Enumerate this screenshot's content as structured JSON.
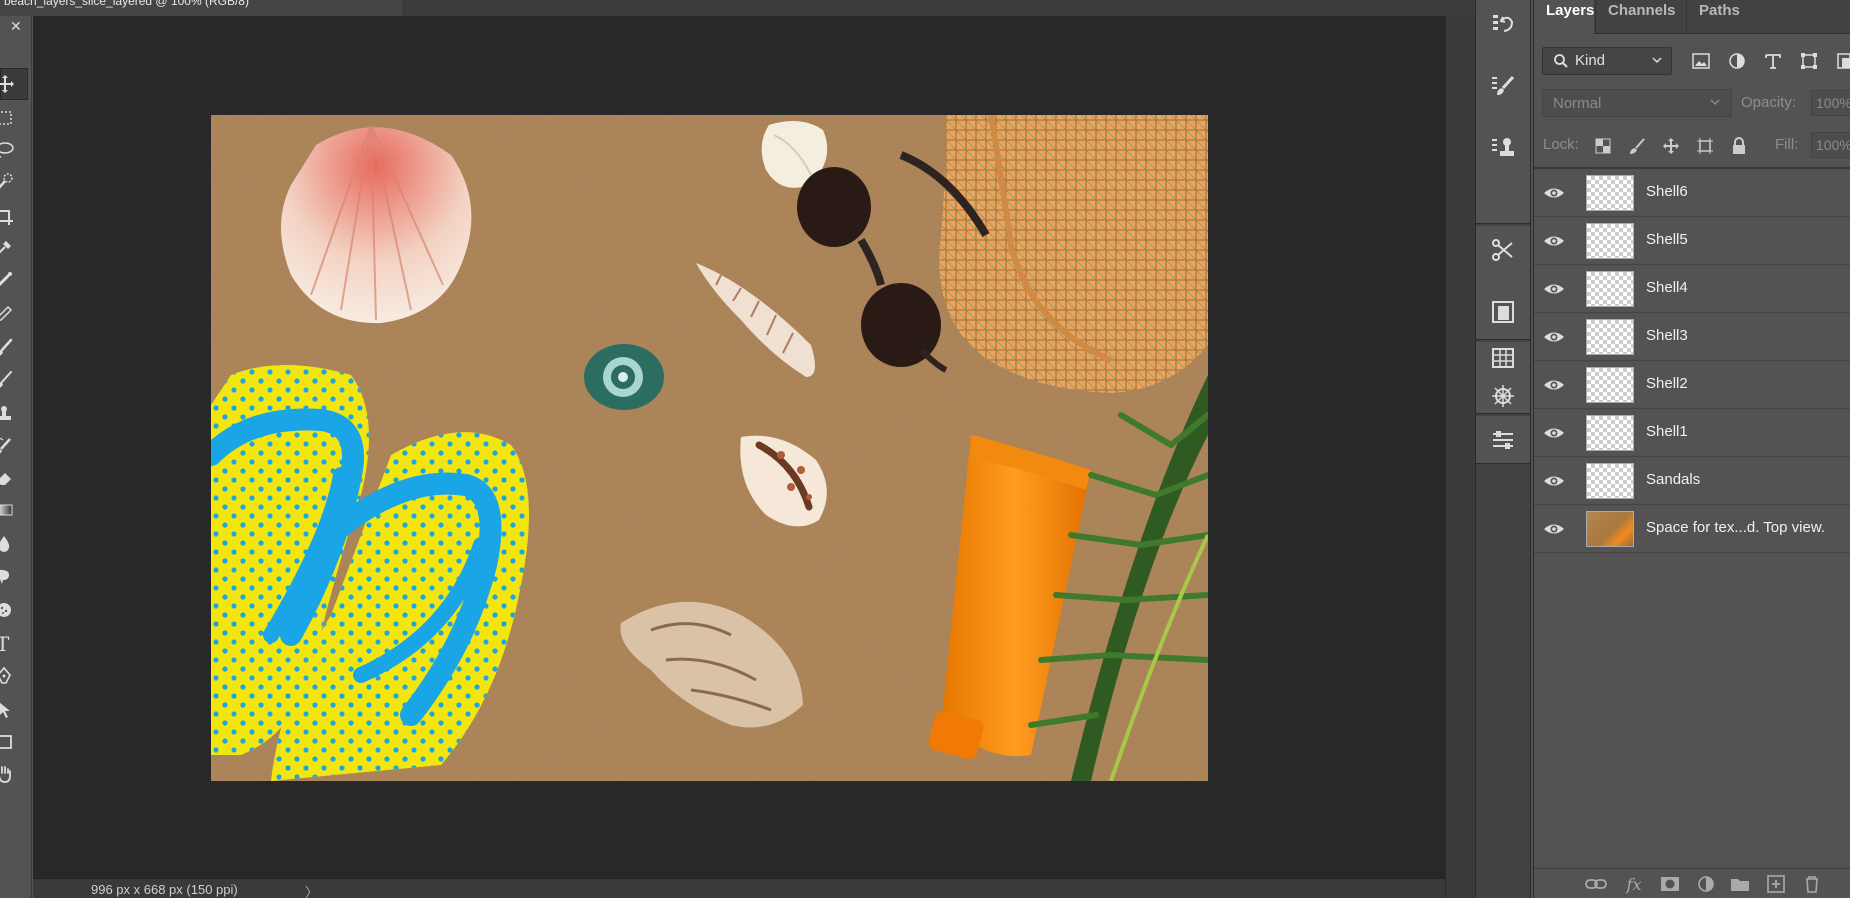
{
  "window": {
    "doc_tab_title": "beach_layers_slice_layered @ 100% (RGB/8)",
    "close_symbol": "×"
  },
  "toolbar": {
    "close_symbol": "✕",
    "tools": [
      {
        "name": "move-tool-icon",
        "active": true
      },
      {
        "name": "rectangular-marquee-icon"
      },
      {
        "name": "lasso-icon"
      },
      {
        "name": "quick-selection-icon"
      },
      {
        "name": "crop-icon"
      },
      {
        "name": "eyedropper-icon"
      },
      {
        "name": "spot-healing-brush-icon"
      },
      {
        "name": "pencil-icon"
      },
      {
        "name": "brush-icon"
      },
      {
        "name": "mixer-brush-icon"
      },
      {
        "name": "clone-stamp-icon"
      },
      {
        "name": "history-brush-icon"
      },
      {
        "name": "eraser-icon"
      },
      {
        "name": "gradient-icon"
      },
      {
        "name": "blur-icon"
      },
      {
        "name": "smudge-icon"
      },
      {
        "name": "sponge-icon"
      },
      {
        "name": "type-tool-icon",
        "glyph": "T"
      },
      {
        "name": "pen-icon"
      },
      {
        "name": "path-selection-icon"
      },
      {
        "name": "rectangle-shape-icon"
      },
      {
        "name": "hand-icon"
      }
    ]
  },
  "status_bar": {
    "doc_info": "996 px x 668 px (150 ppi)",
    "arrow": "〉"
  },
  "dock": {
    "icons": [
      "history-icon",
      "brush-settings-icon",
      "clone-source-icon",
      "tools-presets-icon",
      "libraries-icon",
      "grid-icon",
      "compass-icon",
      "adjustments-icon"
    ]
  },
  "layers_panel": {
    "tabs": [
      {
        "label": "Layers",
        "active": true
      },
      {
        "label": "Channels",
        "active": false
      },
      {
        "label": "Paths",
        "active": false
      }
    ],
    "filter_kind": "Kind",
    "filter_icons": [
      "image-filter-icon",
      "adjustment-filter-icon",
      "type-filter-icon",
      "shape-filter-icon",
      "smart-object-filter-icon"
    ],
    "blend_mode": "Normal",
    "opacity_label": "Opacity:",
    "opacity_value": "100%",
    "lock_label": "Lock:",
    "lock_icons": [
      "lock-transparent-icon",
      "lock-image-icon",
      "lock-position-icon",
      "lock-artboard-icon",
      "lock-all-icon"
    ],
    "fill_label": "Fill:",
    "fill_value": "100%",
    "layers": [
      {
        "name": "Shell6",
        "visible": true,
        "thumb": "transparent"
      },
      {
        "name": "Shell5",
        "visible": true,
        "thumb": "transparent"
      },
      {
        "name": "Shell4",
        "visible": true,
        "thumb": "transparent"
      },
      {
        "name": "Shell3",
        "visible": true,
        "thumb": "transparent"
      },
      {
        "name": "Shell2",
        "visible": true,
        "thumb": "transparent"
      },
      {
        "name": "Shell1",
        "visible": true,
        "thumb": "transparent"
      },
      {
        "name": "Sandals",
        "visible": true,
        "thumb": "transparent"
      },
      {
        "name": "Space for tex...d. Top view.",
        "visible": true,
        "thumb": "photo"
      }
    ],
    "footer_icons": [
      "link-layers-icon",
      "fx-icon",
      "add-mask-icon",
      "new-adjustment-icon",
      "new-group-icon",
      "new-layer-icon",
      "delete-layer-icon"
    ],
    "fx_glyph": "fx"
  },
  "colors": {
    "panel_bg": "#535353",
    "canvas_bg": "#282828",
    "sand": "#b5895a",
    "sandal_yellow": "#f3e60e",
    "strap_blue": "#1aa5e6",
    "tube_orange": "#f5870d"
  }
}
